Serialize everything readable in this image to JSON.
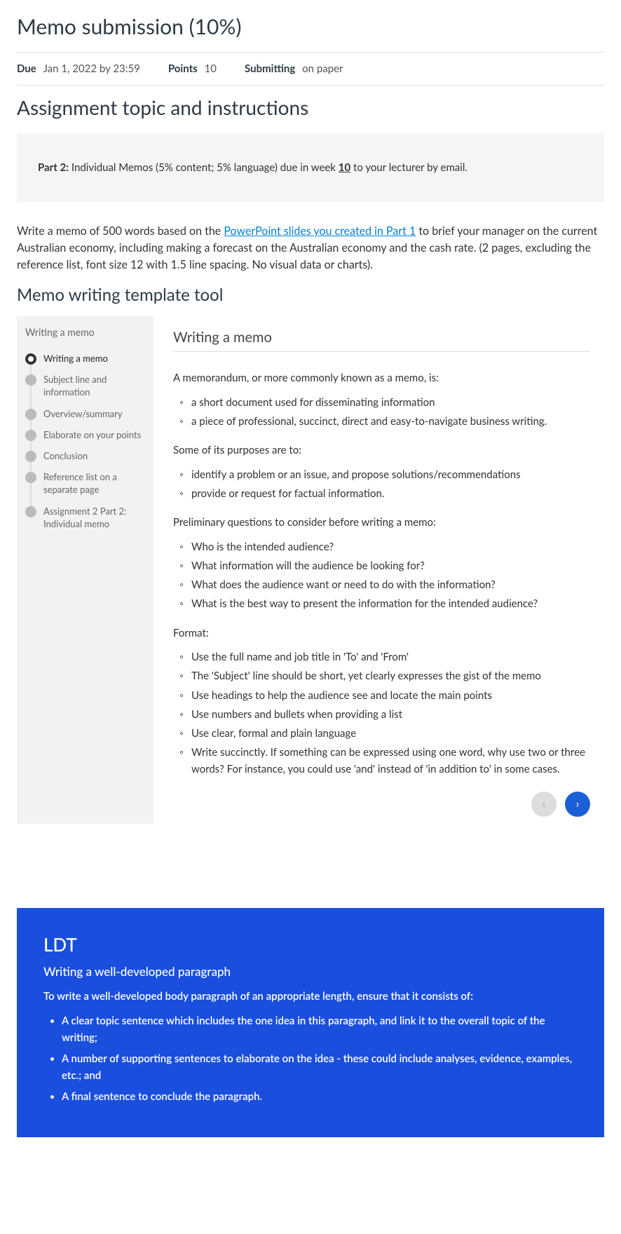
{
  "header": {
    "title": "Memo submission (10%)",
    "due_label": "Due",
    "due_value": "Jan 1, 2022 by 23:59",
    "points_label": "Points",
    "points_value": "10",
    "submitting_label": "Submitting",
    "submitting_value": "on paper"
  },
  "section1_heading": "Assignment topic and instructions",
  "graybox": {
    "bold": "Part 2:",
    "text1": " Individual Memos (5% content; 5% language) due in week ",
    "week": "10",
    "text2": " to your lecturer by email."
  },
  "intro": {
    "pre": "Write a memo of 500 words based on the ",
    "link": "PowerPoint slides you created in Part 1",
    "post": " to brief your manager on the current Australian economy, including making a forecast on the Australian economy and the cash rate. (2 pages, excluding the reference list, font size 12 with 1.5 line spacing. No visual data or charts)."
  },
  "tool_heading": "Memo writing template tool",
  "tool_nav": {
    "title": "Writing a memo",
    "items": [
      "Writing a memo",
      "Subject line and information",
      "Overview/summary",
      "Elaborate on your points",
      "Conclusion",
      "Reference list on a separate page",
      "Assignment 2 Part 2: Individual memo"
    ]
  },
  "tool_content": {
    "title": "Writing a memo",
    "p1": "A memorandum, or more commonly known as a memo, is:",
    "list1": [
      "a short document used for disseminating information",
      "a piece of professional, succinct, direct and easy-to-navigate business writing."
    ],
    "p2": "Some of its purposes are to:",
    "list2": [
      "identify a problem or an issue, and propose solutions/recommendations",
      "provide or request for factual information."
    ],
    "p3": "Preliminary questions to consider before writing a memo:",
    "list3": [
      "Who is the intended audience?",
      "What information will the audience be looking for?",
      "What does the audience want or need to do with the information?",
      "What is the best way to present the information for the intended audience?"
    ],
    "p4": "Format:",
    "list4": [
      "Use the full name and job title in 'To' and 'From'",
      "The 'Subject' line should be short, yet clearly expresses the gist of the memo",
      "Use headings to help the audience see and locate the main points",
      "Use numbers and bullets when providing a list",
      "Use clear, formal and plain language",
      "Write succinctly. If something can be expressed using one word, why use two or three words? For instance, you could use 'and' instead of 'in addition to' in some cases."
    ]
  },
  "bluebox": {
    "title": "LDT",
    "subtitle": "Writing a well-developed paragraph",
    "intro": "To write a well-developed body paragraph of an appropriate length, ensure that it consists of:",
    "items": [
      "A clear topic sentence which includes the one idea in this paragraph, and link it to the overall topic of the writing;",
      "A number of supporting sentences to elaborate on the idea - these could include analyses, evidence, examples, etc.; and",
      "A final sentence to conclude the paragraph."
    ]
  }
}
